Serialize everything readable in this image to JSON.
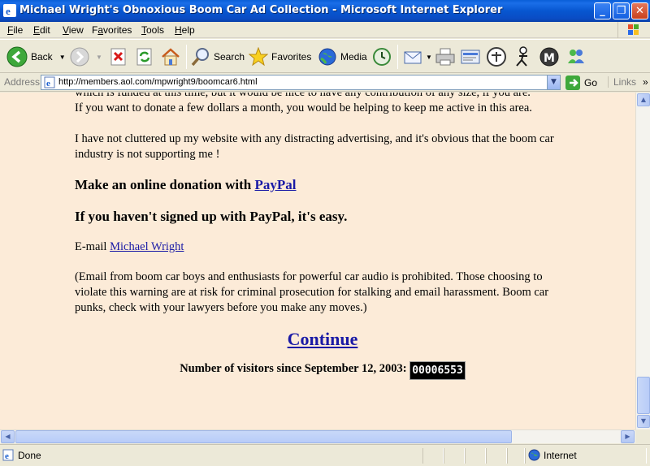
{
  "window": {
    "title": "Michael Wright's Obnoxious Boom Car Ad Collection - Microsoft Internet Explorer",
    "minimize": "_",
    "restore": "❐",
    "close": "✕"
  },
  "menu": {
    "items": [
      {
        "first": "F",
        "rest": "ile"
      },
      {
        "first": "E",
        "rest": "dit"
      },
      {
        "first": "V",
        "rest": "iew"
      },
      {
        "first": "F",
        "rest": "avorites",
        "u_first": false,
        "label_full": "Favorites",
        "underline_index": 1
      },
      {
        "first": "T",
        "rest": "ools"
      },
      {
        "first": "H",
        "rest": "elp"
      }
    ]
  },
  "toolbar": {
    "back": "Back",
    "search": "Search",
    "favorites": "Favorites",
    "media": "Media"
  },
  "address": {
    "label": "Address",
    "url": "http://members.aol.com/mpwright9/boomcar6.html",
    "go": "Go",
    "links": "Links",
    "chevron": "»"
  },
  "page": {
    "clipped_line": "which is funded at this time, but it would be nice to have any contribution of any size, if you are.",
    "para1": "If you want to donate a few dollars a month, you would be helping to keep me active in this area.",
    "para2": "I have not cluttered up my website with any distracting advertising, and it's obvious that the boom car industry is not supporting me !",
    "donate_prefix": "Make an online donation with ",
    "donate_link": "PayPal",
    "signup": "If you haven't signed up with PayPal, it's easy.",
    "email_prefix": "E-mail ",
    "email_link": "Michael Wright",
    "warning": "(Email from boom car boys and enthusiasts for powerful car audio is prohibited. Those choosing to violate this warning are at risk for criminal prosecution for stalking and email harassment. Boom car punks, check with your lawyers before you make any moves.)",
    "continue": "Continue",
    "visitors_label": "Number of visitors since September 12, 2003:",
    "visitor_count": "00006553"
  },
  "status": {
    "text": "Done",
    "zone": "Internet"
  },
  "scroll": {
    "vertical_position": 0.95,
    "horizontal_position": 0.0
  }
}
